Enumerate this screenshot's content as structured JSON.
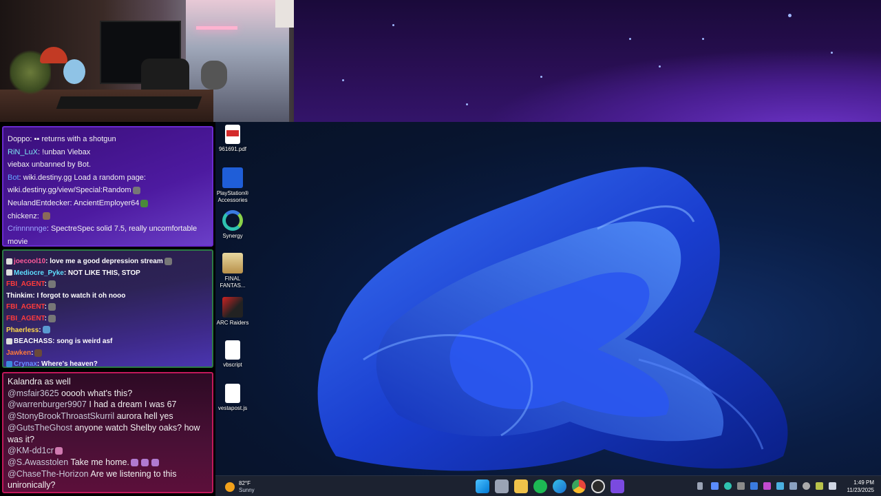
{
  "chat_panel_1": {
    "lines": [
      {
        "user": "Doppo",
        "user_color": "#f2f2f2",
        "text": ": ▪▪ returns with a shotgun"
      },
      {
        "user": "RiN_LuX",
        "user_color": "#7ee8f2",
        "text": ": !unban Viebax"
      },
      {
        "user": "",
        "user_color": "#f2f2f2",
        "text": "viebax unbanned by Bot."
      },
      {
        "user": "Bot",
        "user_color": "#63a4ff",
        "text": ": wiki.destiny.gg Load a random page:"
      },
      {
        "user": "",
        "user_color": "#f2f2f2",
        "text": "wiki.destiny.gg/view/Special:Random"
      },
      {
        "user": "NeulandEntdecker",
        "user_color": "#f2f2f2",
        "text": ": AncientEmployer64"
      },
      {
        "user": "chickenz",
        "user_color": "#f2f2f2",
        "text": ":"
      },
      {
        "user": "Crinnnnnge",
        "user_color": "#9fa8ff",
        "text": ": SpectreSpec solid 7.5, really uncomfortable movie"
      }
    ]
  },
  "chat_panel_2": {
    "lines": [
      {
        "user": "joecool10",
        "user_color": "#ff5a9a",
        "text": ": love me a good depression stream"
      },
      {
        "user": "Mediocre_Pyke",
        "user_color": "#5ee0ff",
        "text": ": NOT LIKE THIS, STOP"
      },
      {
        "user": "FBI_AGENT",
        "user_color": "#ff3b3b",
        "text": ":"
      },
      {
        "user": "Thinkim",
        "user_color": "#ffffff",
        "text": ": I forgot to watch it oh nooo"
      },
      {
        "user": "FBI_AGENT",
        "user_color": "#ff3b3b",
        "text": ":"
      },
      {
        "user": "FBI_AGENT",
        "user_color": "#ff3b3b",
        "text": ":"
      },
      {
        "user": "Phaerless",
        "user_color": "#ffd84a",
        "text": ":"
      },
      {
        "user": "BEACHASS",
        "user_color": "#ffffff",
        "text": ": song is weird asf"
      },
      {
        "user": "Jawken",
        "user_color": "#ff7a3a",
        "text": ":"
      },
      {
        "user": "Crynax",
        "user_color": "#6a8dff",
        "text": ": Where's heaven?"
      }
    ]
  },
  "chat_panel_3": {
    "lines": [
      {
        "mention": "",
        "text": "Kalandra as well"
      },
      {
        "mention": "@msfair3625",
        "text": " ooooh what's this?"
      },
      {
        "mention": "@warrenburger9907",
        "text": " I had a dream I was 67"
      },
      {
        "mention": "@StonyBrookThroastSkurril",
        "text": " aurora hell yes"
      },
      {
        "mention": "@GutsTheGhost",
        "text": " anyone watch Shelby oaks? how was it?"
      },
      {
        "mention": "@KM-dd1cr",
        "text": ""
      },
      {
        "mention": "@S.Awasstolen",
        "text": " Take me home."
      },
      {
        "mention": "@ChaseThe-Horizon",
        "text": " Are we listening to this unironically?"
      }
    ]
  },
  "desktop_icons": [
    {
      "label": "961691.pdf",
      "icon": "pdf-file-icon"
    },
    {
      "label": "PlayStation® Accessories",
      "icon": "playstation-accessories-icon"
    },
    {
      "label": "Synergy",
      "icon": "synergy-icon"
    },
    {
      "label": "FINAL FANTAS...",
      "icon": "final-fantasy-icon"
    },
    {
      "label": "ARC Raiders",
      "icon": "arc-raiders-icon"
    },
    {
      "label": "vbscript",
      "icon": "blank-file-icon"
    },
    {
      "label": "vestapost.js",
      "icon": "blank-file-icon"
    }
  ],
  "taskbar": {
    "weather_temp": "82°F",
    "weather_desc": "Sunny",
    "apps": [
      "windows-start-icon",
      "task-view-icon",
      "file-explorer-icon",
      "spotify-icon",
      "edge-icon",
      "chrome-icon",
      "obs-icon",
      "vpn-icon"
    ],
    "time": "1:49 PM",
    "date": "11/23/2025"
  },
  "colors": {
    "accent_purple": "#6a2ad0",
    "accent_green": "#2b7b45",
    "accent_pink": "#c2185b",
    "taskbar_bg": "#1c2230"
  }
}
